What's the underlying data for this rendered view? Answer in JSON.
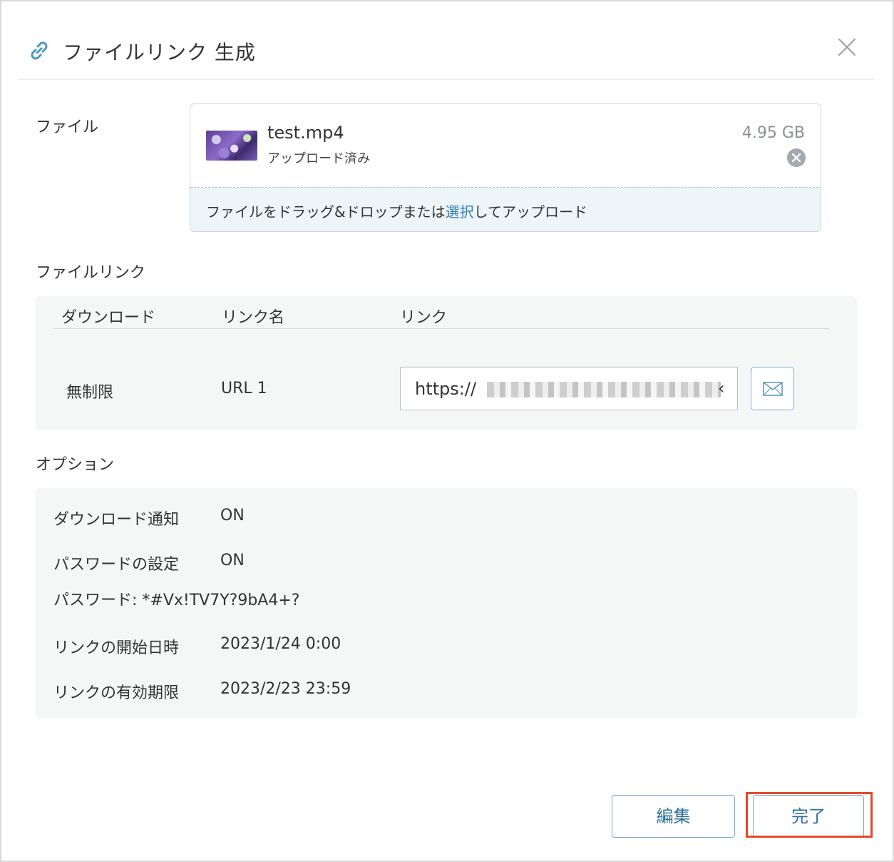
{
  "dialog": {
    "title": "ファイルリンク 生成",
    "icons": {
      "title": "link-icon",
      "close": "close-icon"
    }
  },
  "file_section": {
    "label": "ファイル",
    "file": {
      "name": "test.mp4",
      "status": "アップロード済み",
      "size": "4.95 GB",
      "remove_icon": "remove-circle-icon"
    },
    "dropzone": {
      "text_before": "ファイルをドラッグ&ドロップまたは",
      "link": "選択",
      "text_after": "してアップロード"
    }
  },
  "link_section": {
    "label": "ファイルリンク",
    "columns": [
      "ダウンロード",
      "リンク名",
      "リンク"
    ],
    "row": {
      "download": "無制限",
      "name": "URL 1",
      "url": "https://"
    },
    "mail_icon": "mail-icon"
  },
  "options_section": {
    "label": "オプション",
    "items": [
      {
        "key": "ダウンロード通知",
        "value": "ON"
      },
      {
        "key": "パスワードの設定",
        "value": "ON"
      },
      {
        "key": "パスワード: *#Vx!TV7Y?9bA4+?",
        "value": ""
      },
      {
        "key": "リンクの開始日時",
        "value": "2023/1/24 0:00"
      },
      {
        "key": "リンクの有効期限",
        "value": "2023/2/23 23:59"
      }
    ]
  },
  "footer": {
    "edit_label": "編集",
    "done_label": "完了"
  },
  "colors": {
    "accent": "#2e7eb8",
    "button_text": "#2e6f96",
    "highlight": "#e04a2a",
    "panel_bg": "#f5f6f6",
    "dropzone_bg": "#eef5f8"
  }
}
